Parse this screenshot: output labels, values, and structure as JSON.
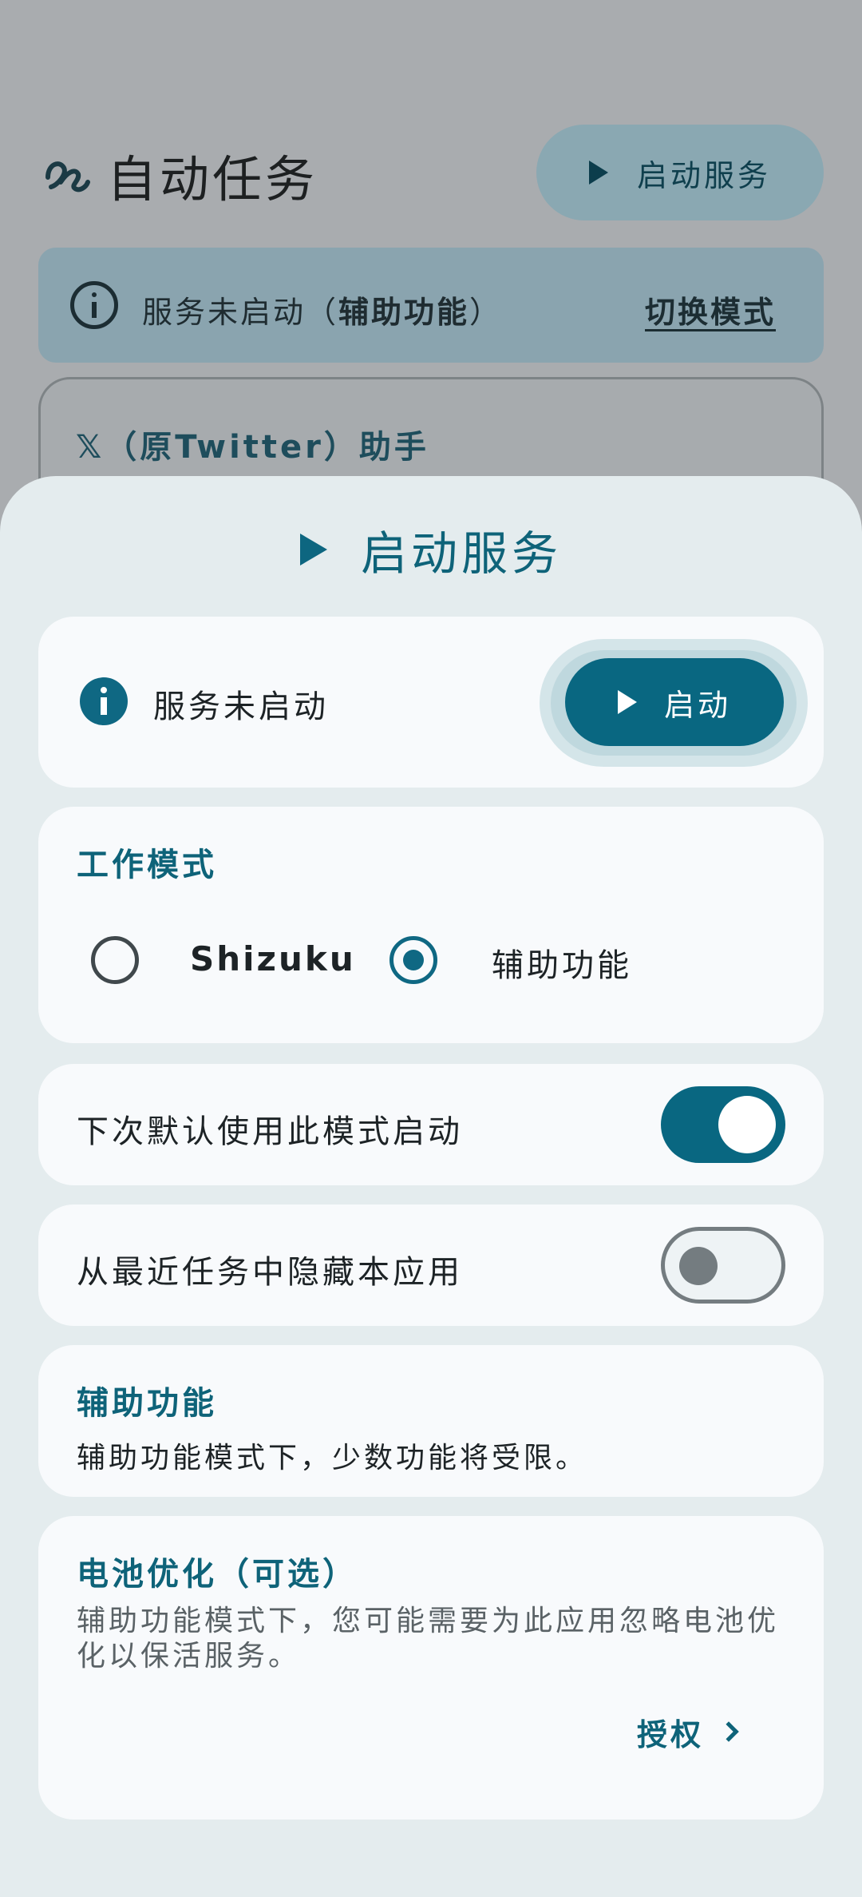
{
  "app": {
    "title": "自动任务",
    "start_chip_label": "启动服务"
  },
  "status_banner": {
    "text_prefix": "服务未启动（",
    "text_bold": "辅助功能",
    "text_suffix": "）",
    "switch_mode_label": "切换模式"
  },
  "x_card": {
    "title": "𝕏（原Twitter）助手"
  },
  "sheet": {
    "title": "启动服务",
    "status": {
      "label": "服务未启动",
      "start_button_label": "启动"
    },
    "work_mode": {
      "title": "工作模式",
      "options": [
        {
          "label": "Shizuku",
          "selected": false
        },
        {
          "label": "辅助功能",
          "selected": true
        }
      ]
    },
    "default_mode": {
      "label": "下次默认使用此模式启动",
      "enabled": true
    },
    "hide_recents": {
      "label": "从最近任务中隐藏本应用",
      "enabled": false
    },
    "accessibility_info": {
      "title": "辅助功能",
      "description": "辅助功能模式下，少数功能将受限。"
    },
    "battery": {
      "title": "电池优化（可选）",
      "description": "辅助功能模式下，您可能需要为此应用忽略电池优化以保活服务。",
      "grant_label": "授权"
    }
  },
  "colors": {
    "primary": "#096781",
    "scrim_background": "#a9acaf",
    "sheet_background": "#e4ecee",
    "card_background": "#f8fafc"
  }
}
